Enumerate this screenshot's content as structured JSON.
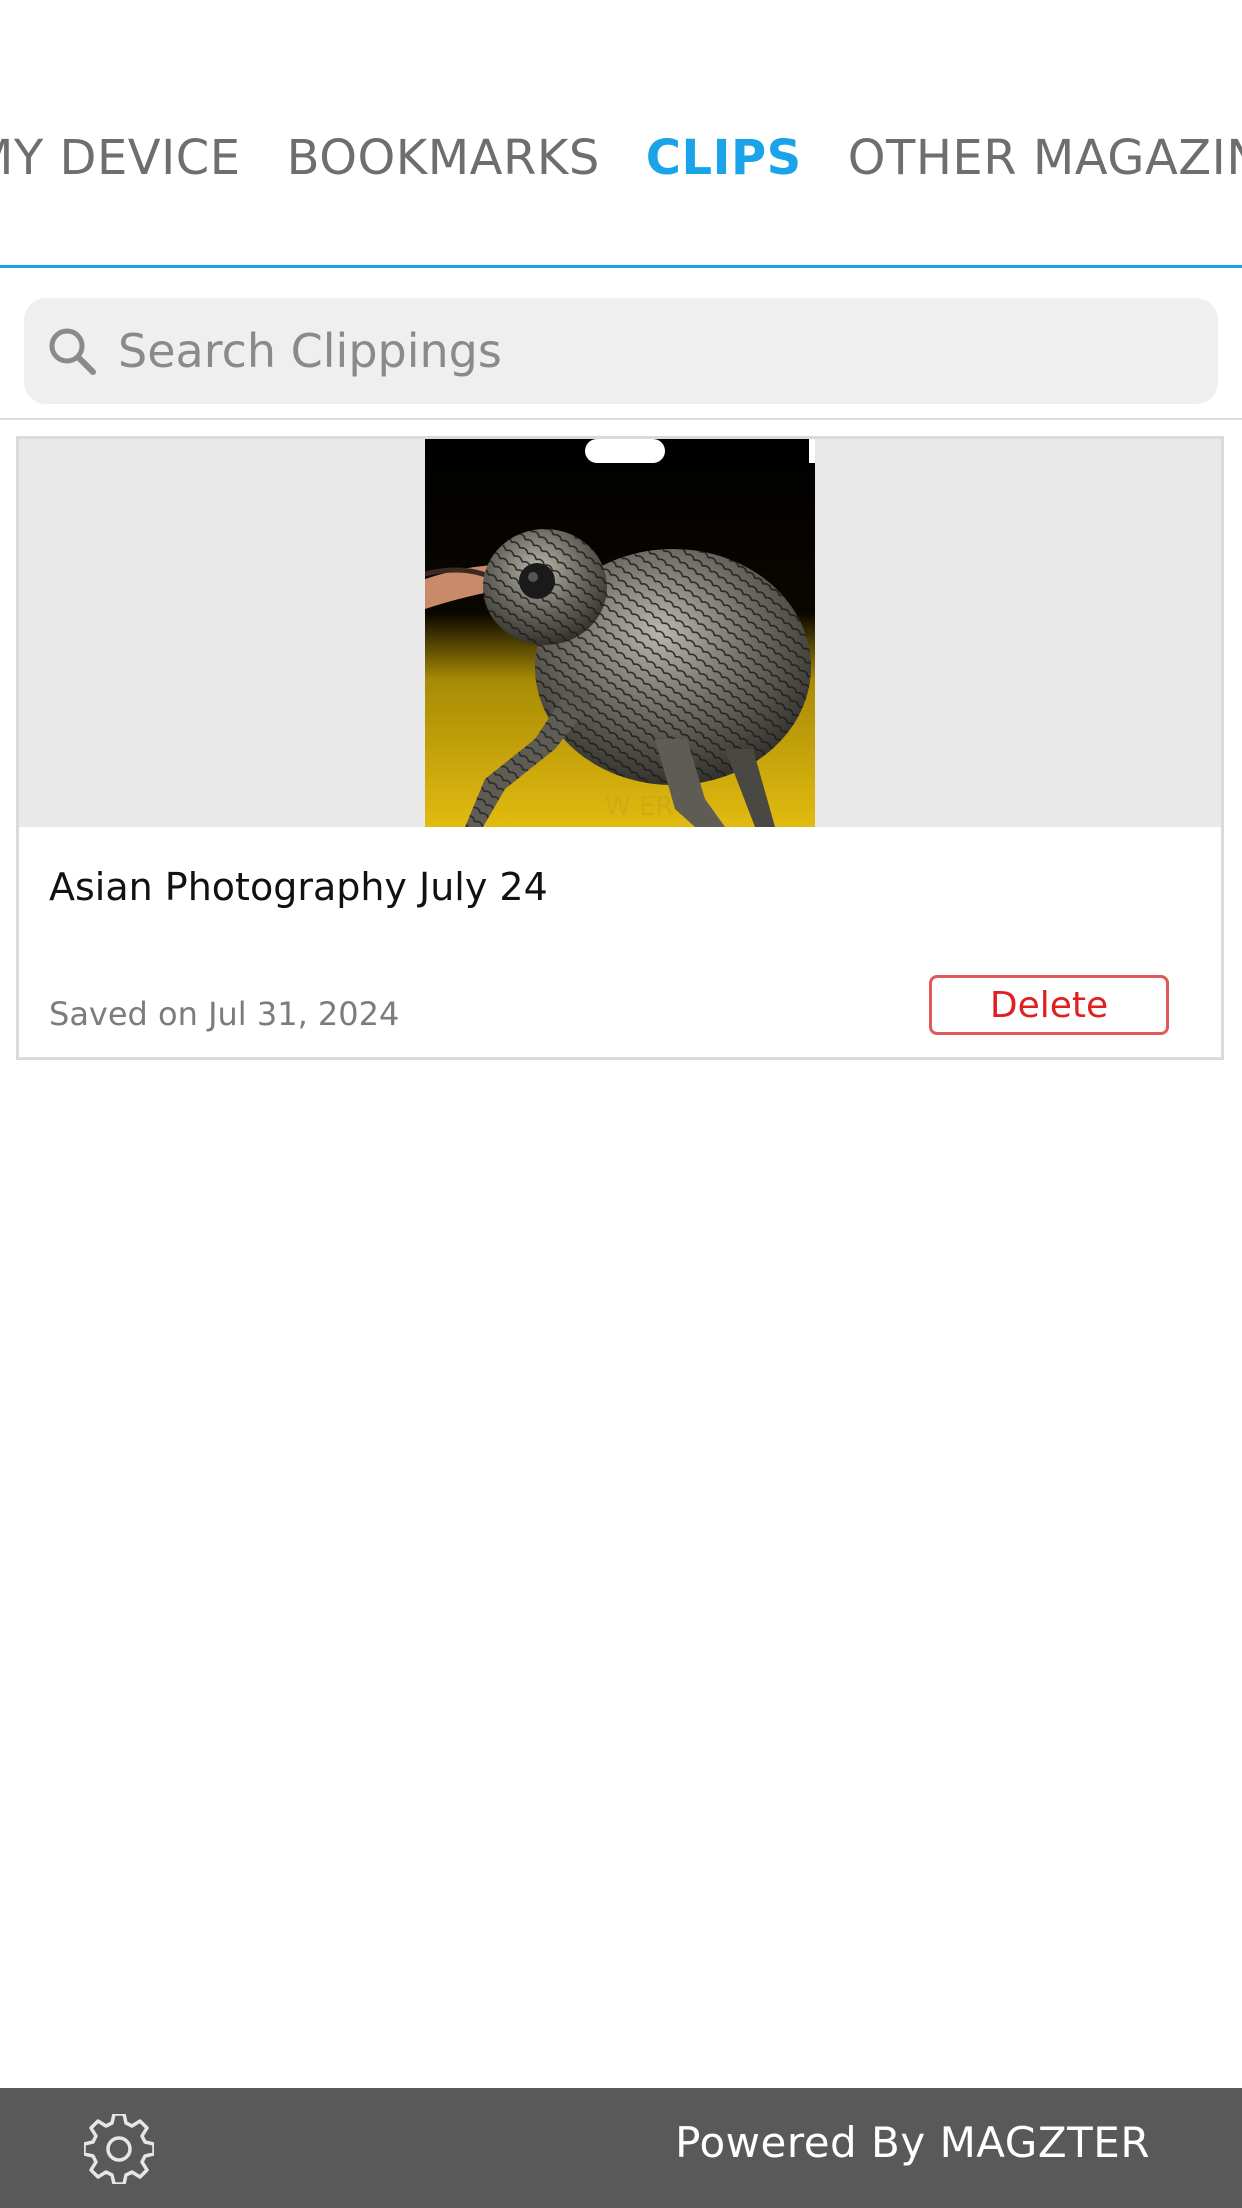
{
  "tabs": {
    "items": [
      {
        "label": "MY DEVICE",
        "active": false
      },
      {
        "label": "BOOKMARKS",
        "active": false
      },
      {
        "label": "CLIPS",
        "active": true
      },
      {
        "label": "OTHER MAGAZINES",
        "active": false
      }
    ]
  },
  "colors": {
    "accent": "#1aa3e8",
    "delete": "#e02020",
    "footer_bg": "#595959"
  },
  "search": {
    "placeholder": "Search Clippings",
    "value": "",
    "icon": "search-icon"
  },
  "clips": [
    {
      "title": "Asian Photography July 24",
      "saved": "Saved on Jul 31, 2024",
      "delete_label": "Delete",
      "thumbnail": "weevil insect macro photo"
    }
  ],
  "footer": {
    "settings_icon": "gear-icon",
    "powered_by": "Powered By MAGZTER"
  }
}
